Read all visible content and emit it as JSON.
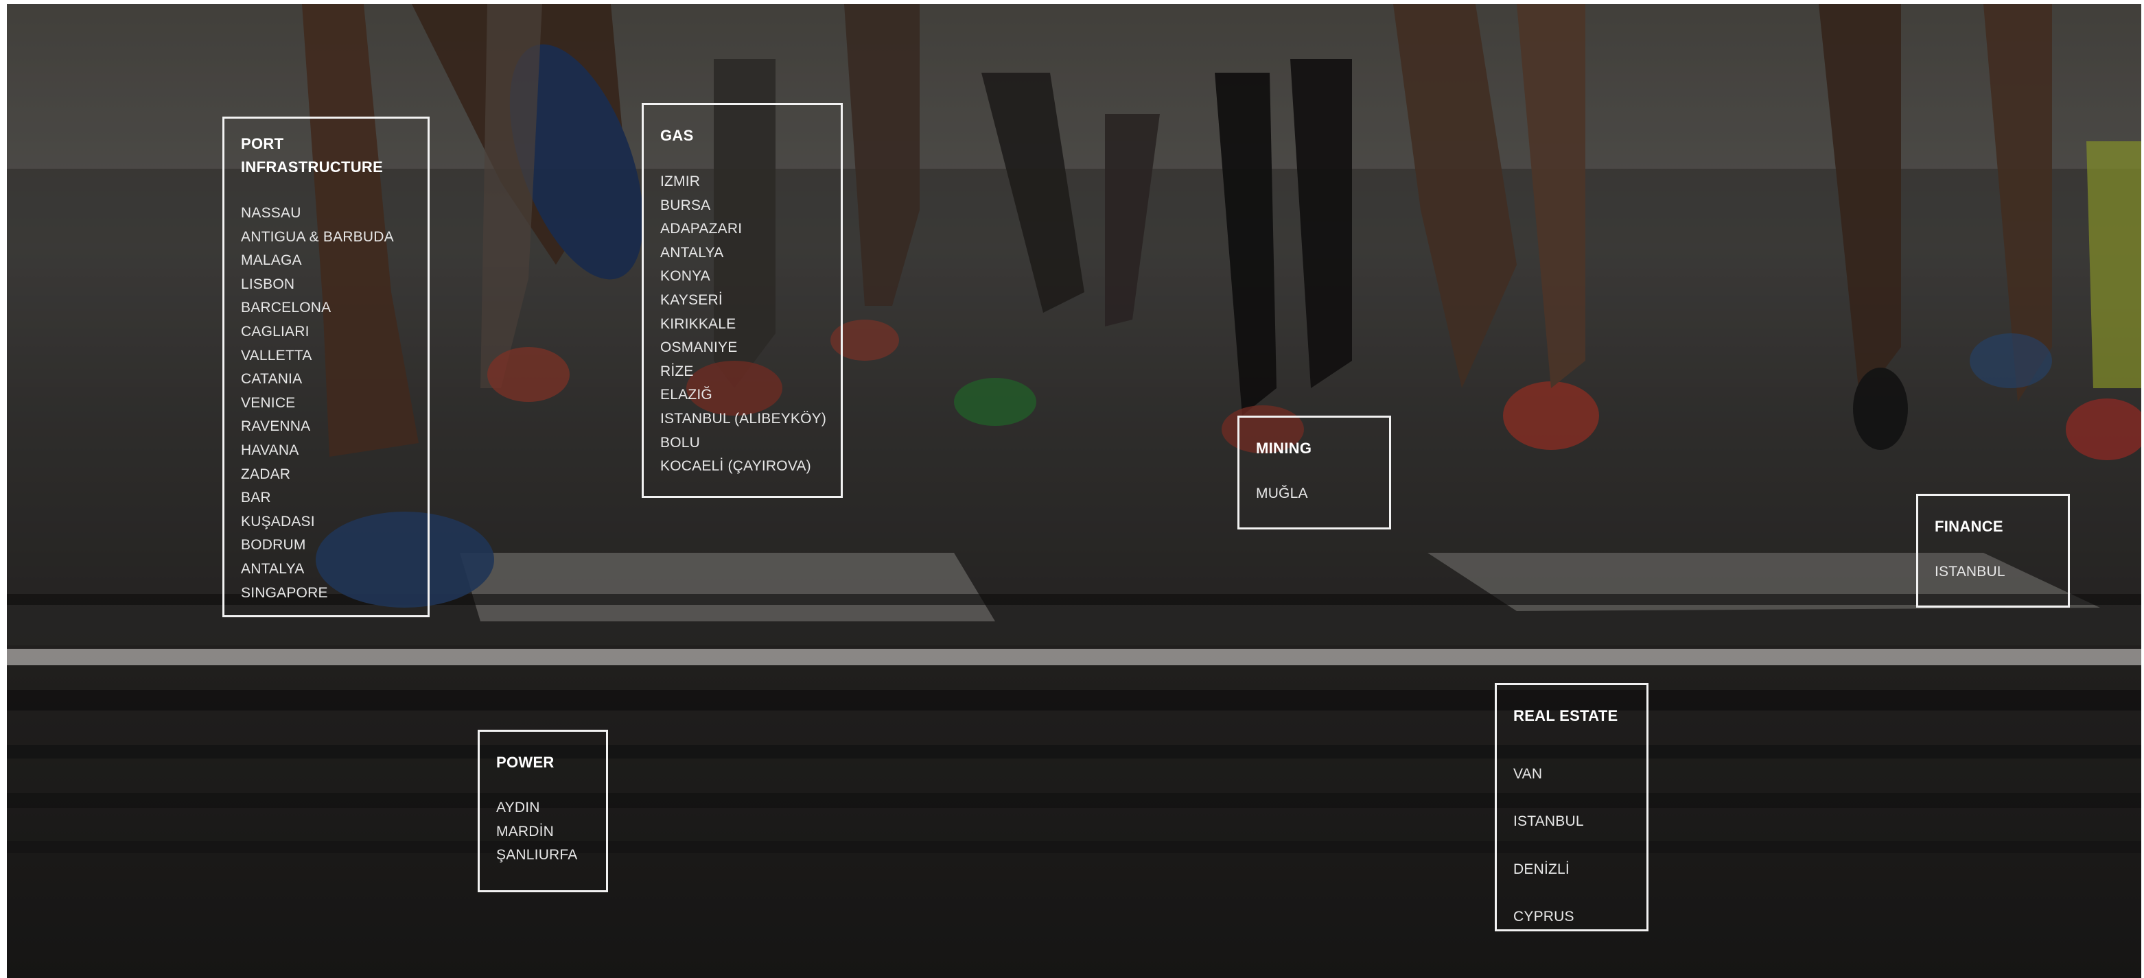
{
  "categories": [
    {
      "id": "port",
      "title": "PORT INFRASTRUCTURE",
      "items": [
        "NASSAU",
        "ANTIGUA & BARBUDA",
        "MALAGA",
        "LISBON",
        "BARCELONA",
        "CAGLIARI",
        "VALLETTA",
        "CATANIA",
        "VENICE",
        "RAVENNA",
        "HAVANA",
        "ZADAR",
        "BAR",
        "KUŞADASI",
        "BODRUM",
        "ANTALYA",
        "SINGAPORE"
      ]
    },
    {
      "id": "gas",
      "title": "GAS",
      "items": [
        "IZMIR",
        "BURSA",
        "ADAPAZARI",
        "ANTALYA",
        "KONYA",
        "KAYSERİ",
        "KIRIKKALE",
        "OSMANIYE",
        "RİZE",
        "ELAZIĞ",
        "ISTANBUL (ALIBEYKÖY)",
        "BOLU",
        "KOCAELİ (ÇAYIROVA)"
      ]
    },
    {
      "id": "mining",
      "title": "MINING",
      "items": [
        "MUĞLA"
      ]
    },
    {
      "id": "finance",
      "title": "FINANCE",
      "items": [
        "ISTANBUL"
      ]
    },
    {
      "id": "power",
      "title": "POWER",
      "items": [
        "AYDIN",
        "MARDİN",
        "ŞANLIURFA"
      ]
    },
    {
      "id": "realestate",
      "title": "REAL ESTATE",
      "items": [
        "VAN",
        "ISTANBUL",
        "DENİZLİ",
        "CYPRUS"
      ]
    }
  ],
  "background": {
    "subject": "marathon-runners-legs-photo",
    "tint": "#000000"
  }
}
